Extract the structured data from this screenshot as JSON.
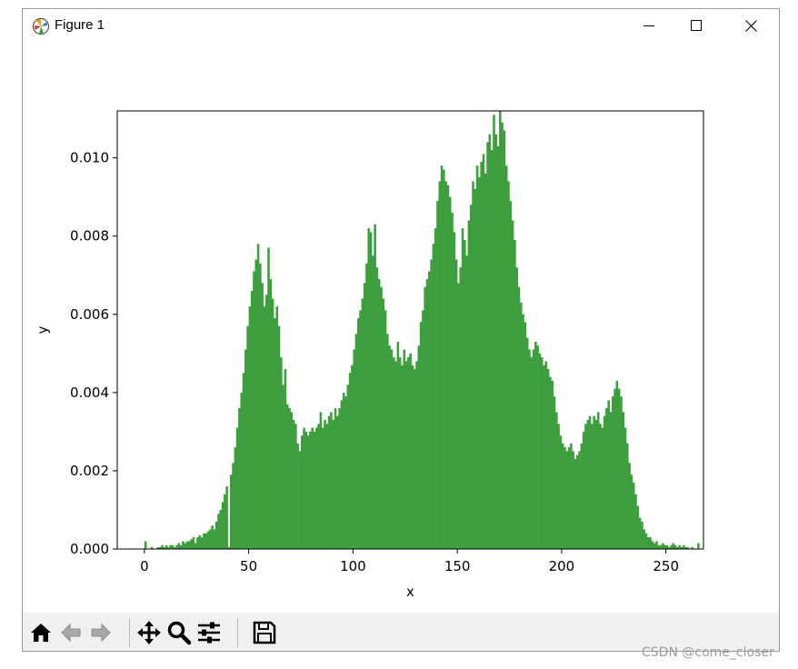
{
  "window": {
    "title": "Figure 1",
    "controls": [
      "minimize-icon",
      "maximize-icon",
      "close-icon"
    ]
  },
  "toolbar": {
    "buttons": [
      "home-icon",
      "back-arrow-icon",
      "forward-arrow-icon",
      "pan-icon",
      "zoom-icon",
      "configure-subplots-icon",
      "save-icon"
    ]
  },
  "watermark": "CSDN @come_closer",
  "colors": {
    "bar": "#3d9e3d",
    "axes": "#000000",
    "toolbar_bg": "#f0f0f0"
  },
  "chart_data": {
    "type": "bar",
    "title": "",
    "xlabel": "x",
    "ylabel": "y",
    "xlim": [
      -13,
      268
    ],
    "ylim": [
      0,
      0.0112
    ],
    "xticks": [
      0,
      50,
      100,
      150,
      200,
      250
    ],
    "xtick_labels": [
      "0",
      "50",
      "100",
      "150",
      "200",
      "250"
    ],
    "yticks": [
      0,
      0.002,
      0.004,
      0.006,
      0.008,
      0.01
    ],
    "ytick_labels": [
      "0.000",
      "0.002",
      "0.004",
      "0.006",
      "0.008",
      "0.010"
    ],
    "bins": 256,
    "bin_start": 0,
    "bin_width": 1,
    "values": [
      0.0002,
      0,
      0,
      5e-05,
      0,
      0,
      5e-05,
      5e-05,
      0.0001,
      5e-05,
      0.0001,
      5e-05,
      0.0001,
      0.0001,
      5e-05,
      0.0001,
      0.00015,
      0.0001,
      0.0002,
      0.00015,
      0.0002,
      0.0002,
      0.00025,
      0.0003,
      0.00015,
      0.0003,
      0.00035,
      0.0003,
      0.0004,
      0.0004,
      0.00045,
      0.0005,
      0.0006,
      0.0005,
      0.0007,
      0.0009,
      0.001,
      0.0012,
      0.0014,
      0.0016,
      5e-05,
      0.0019,
      0.0022,
      0.0026,
      0.0031,
      0.0036,
      0.004,
      0.0045,
      0.0051,
      0.0057,
      0.0062,
      0.0066,
      0.0071,
      0.0074,
      0.0078,
      0.0073,
      0.0068,
      0.0062,
      0.0065,
      0.0077,
      0.0069,
      0.0064,
      0.0059,
      0.0062,
      0.0057,
      0.0049,
      0.0042,
      0.0046,
      0.0037,
      0.0036,
      0.0035,
      0.0033,
      0.0032,
      0.0027,
      0.0025,
      0.0029,
      0.0031,
      0.003,
      0.0029,
      0.003,
      0.0031,
      0.003,
      0.0031,
      0.0032,
      0.0035,
      0.0031,
      0.0033,
      0.0032,
      0.0034,
      0.0035,
      0.0033,
      0.0036,
      0.0034,
      0.0036,
      0.0038,
      0.004,
      0.0039,
      0.0042,
      0.0045,
      0.0047,
      0.0051,
      0.0055,
      0.0059,
      0.0061,
      0.0064,
      0.0068,
      0.0073,
      0.0082,
      0.0081,
      0.0075,
      0.0083,
      0.0072,
      0.0069,
      0.0067,
      0.0064,
      0.0061,
      0.0055,
      0.0052,
      0.0051,
      0.0049,
      0.0048,
      0.0053,
      0.0049,
      0.0047,
      0.0051,
      0.0048,
      0.0049,
      0.005,
      0.0047,
      0.0046,
      0.0048,
      0.0052,
      0.0058,
      0.0061,
      0.0067,
      0.0069,
      0.0071,
      0.0074,
      0.0078,
      0.0082,
      0.0089,
      0.0094,
      0.0098,
      0.0097,
      0.0094,
      0.0093,
      0.009,
      0.0086,
      0.0081,
      0.0074,
      0.0068,
      0.0072,
      0.0082,
      0.0079,
      0.0075,
      0.0084,
      0.0088,
      0.0094,
      0.0092,
      0.0098,
      0.0095,
      0.0099,
      0.0101,
      0.0096,
      0.0104,
      0.0106,
      0.0102,
      0.0111,
      0.0106,
      0.0103,
      0.0112,
      0.0109,
      0.0107,
      0.0098,
      0.0094,
      0.0089,
      0.0084,
      0.0079,
      0.0072,
      0.0067,
      0.0063,
      0.006,
      0.0058,
      0.0054,
      0.0051,
      0.0049,
      0.0051,
      0.0053,
      0.0052,
      0.005,
      0.0049,
      0.0047,
      0.0048,
      0.0046,
      0.0044,
      0.0043,
      0.0039,
      0.0035,
      0.0032,
      0.0029,
      0.0027,
      0.0026,
      0.0025,
      0.0026,
      0.0027,
      0.0025,
      0.0023,
      0.0024,
      0.0025,
      0.0027,
      0.003,
      0.0032,
      0.0033,
      0.0034,
      0.0032,
      0.0034,
      0.0033,
      0.0035,
      0.0032,
      0.0031,
      0.0034,
      0.0036,
      0.0038,
      0.0035,
      0.0039,
      0.0041,
      0.0043,
      0.0041,
      0.0039,
      0.0035,
      0.0031,
      0.0027,
      0.0022,
      0.0019,
      0.0017,
      0.0014,
      0.0011,
      0.0008,
      0.0007,
      0.0005,
      0.0004,
      0.0003,
      0.0003,
      0.0002,
      0.00015,
      0.0002,
      0.0001,
      0.0001,
      0.00015,
      0.0001,
      0.0001,
      5e-05,
      0.0001,
      0.00015,
      0.0001,
      5e-05,
      0.0001,
      5e-05,
      0.0001,
      5e-05,
      5e-05,
      0,
      5e-05,
      0,
      0,
      0.00015,
      0
    ]
  }
}
